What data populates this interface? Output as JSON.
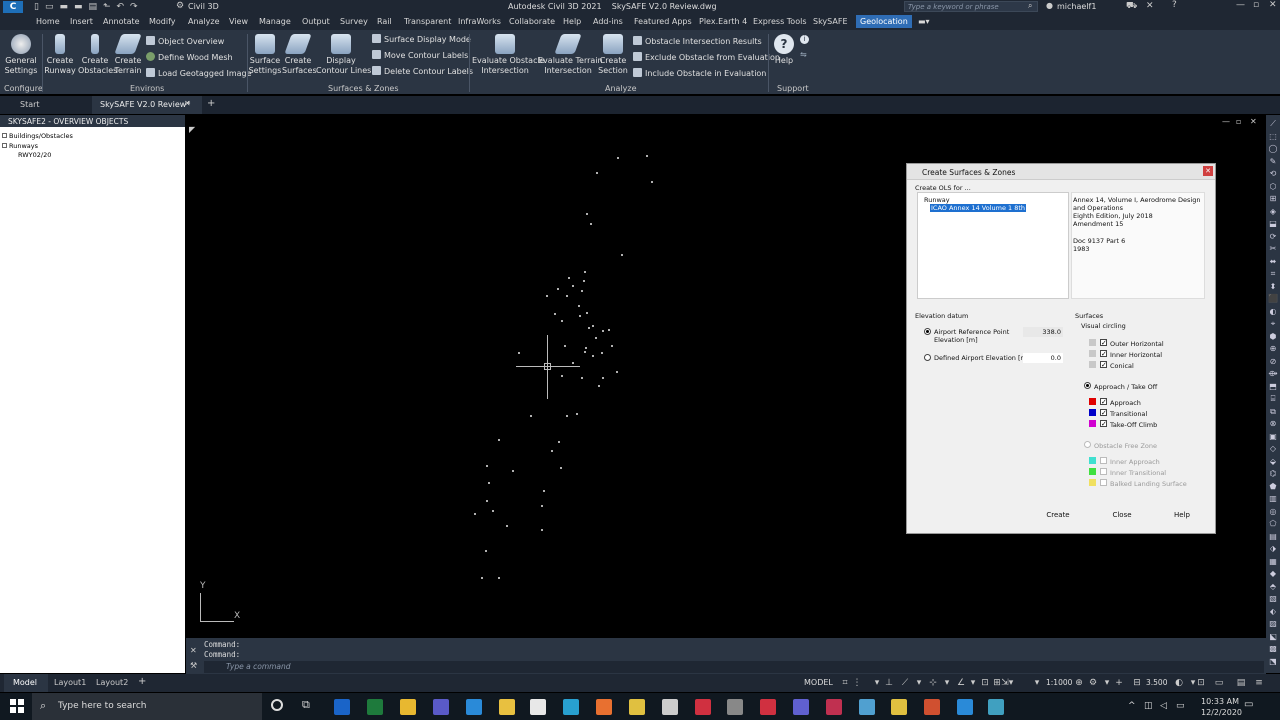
{
  "titlebar": {
    "app_name": "Civil 3D",
    "title": "Autodesk Civil 3D 2021    SkySAFE V2.0 Review.dwg",
    "search_placeholder": "Type a keyword or phrase",
    "user": "michaelf1"
  },
  "menu": [
    "Home",
    "Insert",
    "Annotate",
    "Modify",
    "Analyze",
    "View",
    "Manage",
    "Output",
    "Survey",
    "Rail",
    "Transparent",
    "InfraWorks",
    "Collaborate",
    "Help",
    "Add-ins",
    "Featured Apps",
    "Plex.Earth 4",
    "Express Tools",
    "SkySAFE",
    "Geolocation"
  ],
  "ribbon": {
    "configure": {
      "general_settings": "General\nSettings",
      "label": "Configure"
    },
    "environs": {
      "create_runway": "Create\nRunway",
      "create_obstacles": "Create\nObstacles",
      "create_terrain": "Create\nTerrain",
      "object_overview": "Object Overview",
      "define_wood_mesh": "Define Wood Mesh",
      "load_geotagged_image": "Load Geotagged Image",
      "label": "Environs"
    },
    "surfaces": {
      "surface_settings": "Surface\nSettings",
      "create_surfaces": "Create\nSurfaces",
      "display_contour_lines": "Display\nContour Lines",
      "surface_display_mode": "Surface Display Mode",
      "move_contour_labels": "Move Contour Labels",
      "delete_contour_labels": "Delete Contour Labels",
      "label": "Surfaces & Zones"
    },
    "analyze": {
      "evaluate_obstacle_intersection": "Evaluate Obstacle\nIntersection",
      "evaluate_terrain_intersection": "Evaluate Terrain\nIntersection",
      "create_section": "Create\nSection",
      "obstacle_intersection_results": "Obstacle Intersection Results",
      "exclude_obstacle": "Exclude Obstacle from Evaluation",
      "include_obstacle": "Include Obstacle in Evaluation",
      "label": "Analyze"
    },
    "support": {
      "help": "Help",
      "label": "Support"
    }
  },
  "doctabs": {
    "start": "Start",
    "active": "SkySAFE V2.0 Review*"
  },
  "tree": {
    "header": "SKYSAFE2 - OVERVIEW OBJECTS",
    "items": [
      "Buildings/Obstacles",
      "Runways",
      "RWY02/20"
    ]
  },
  "dialog": {
    "title": "Create Surfaces & Zones",
    "create_ols_for": "Create OLS for ...",
    "tree_runway": "Runway",
    "tree_selected": "ICAO Annex 14 Volume 1 8th",
    "info_lines": [
      "Annex 14, Volume I, Aerodrome Design",
      "and Operations",
      "Eighth Edition, July 2018",
      "Amendment 15",
      "",
      "Doc 9137 Part 6",
      "1983"
    ],
    "elevation_datum": "Elevation datum",
    "arp_label": "Airport Reference Point\nElevation [m]",
    "arp_value": "338.0",
    "defined_label": "Defined Airport Elevation [m]",
    "defined_value": "0.0",
    "surfaces_header": "Surfaces",
    "visual_circling": "Visual circling",
    "outer_horizontal": "Outer Horizontal",
    "inner_horizontal": "Inner Horizontal",
    "conical": "Conical",
    "approach_takeoff": "Approach / Take Off",
    "approach": "Approach",
    "transitional": "Transitional",
    "takeoff_climb": "Take-Off Climb",
    "ofz": "Obstacle Free Zone",
    "inner_approach": "Inner Approach",
    "inner_transitional": "Inner Transitional",
    "balked_landing": "Balked Landing Surface",
    "create_btn": "Create",
    "close_btn": "Close",
    "help_btn": "Help",
    "colors": {
      "approach": "#e00000",
      "transitional": "#0000c8",
      "takeoff": "#d000d0",
      "inner_approach": "#40e0d0",
      "inner_transitional": "#40e040",
      "balked": "#f0e060"
    }
  },
  "command": {
    "line1": "Command:",
    "line2": "Command:",
    "placeholder": "Type a command"
  },
  "statusbar": {
    "model": "Model",
    "layout1": "Layout1",
    "layout2": "Layout2",
    "model_space": "MODEL",
    "scale": "1:1000",
    "lineweight": "3.500"
  },
  "taskbar": {
    "search": "Type here to search",
    "time": "10:33 AM",
    "date": "12/2/2020"
  }
}
